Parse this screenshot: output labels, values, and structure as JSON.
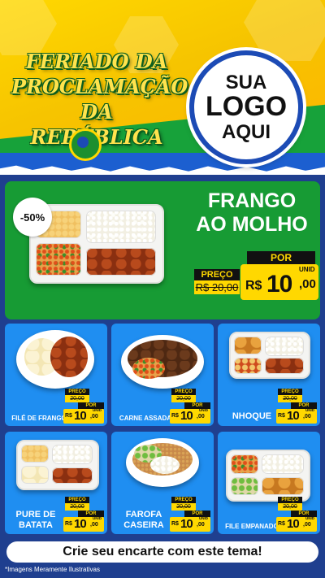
{
  "header": {
    "title_lines": [
      "FERIADO DA",
      "PROCLAMAÇÃO",
      "DA REPÚBLICA"
    ],
    "logo_lines": [
      "SUA",
      "LOGO",
      "AQUI"
    ]
  },
  "featured": {
    "badge": "-50%",
    "name_lines": [
      "FRANGO",
      "AO MOLHO"
    ],
    "preco_label": "PREÇO",
    "old_price": "R$ 20,00",
    "por_label": "POR",
    "currency": "R$",
    "price_int": "10",
    "price_cents": ",00",
    "unit": "UNID"
  },
  "products": [
    {
      "name": "FILÉ DE FRANGO",
      "preco_label": "PREÇO",
      "old_price": "20,00",
      "por_label": "POR",
      "currency": "R$",
      "price_int": "10",
      "price_cents": ",00",
      "unit": "UNID"
    },
    {
      "name": "CARNE ASSADA",
      "preco_label": "PREÇO",
      "old_price": "20,00",
      "por_label": "POR",
      "currency": "R$",
      "price_int": "10",
      "price_cents": ",00",
      "unit": "UNID"
    },
    {
      "name": "NHOQUE",
      "preco_label": "PREÇO",
      "old_price": "20,00",
      "por_label": "POR",
      "currency": "R$",
      "price_int": "10",
      "price_cents": ",00",
      "unit": "UNID"
    },
    {
      "name_lines": [
        "PURE DE",
        "BATATA"
      ],
      "preco_label": "PREÇO",
      "old_price": "20,00",
      "por_label": "POR",
      "currency": "R$",
      "price_int": "10",
      "price_cents": ",00",
      "unit": "UNID"
    },
    {
      "name_lines": [
        "FAROFA",
        "CASEIRA"
      ],
      "preco_label": "PREÇO",
      "old_price": "20,00",
      "por_label": "POR",
      "currency": "R$",
      "price_int": "10",
      "price_cents": ",00",
      "unit": "UNID"
    },
    {
      "name": "FILE EMPANADO",
      "preco_label": "PREÇO",
      "old_price": "20,00",
      "por_label": "POR",
      "currency": "R$",
      "price_int": "10",
      "price_cents": ",00",
      "unit": "UNID"
    }
  ],
  "cta": "Crie seu encarte com este tema!",
  "footnote": "*Imagens Meramente Ilustrativas",
  "colors": {
    "yellow": "#ffd800",
    "green": "#179b34",
    "blue": "#1f8ef1",
    "navy": "#1f3f8f"
  }
}
